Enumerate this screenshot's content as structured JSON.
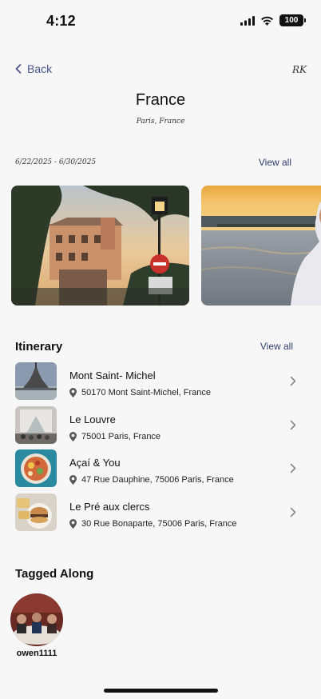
{
  "status": {
    "time": "4:12",
    "battery": "100"
  },
  "nav": {
    "back_label": "Back",
    "user_initials": "RK"
  },
  "trip": {
    "title": "France",
    "location": "Paris, France",
    "dates": "6/22/2025 - 6/30/2025",
    "photos_view_all": "View all"
  },
  "itinerary": {
    "title": "Itinerary",
    "view_all": "View all",
    "items": [
      {
        "name": "Mont Saint- Michel",
        "address": "50170 Mont Saint-Michel, France"
      },
      {
        "name": "Le Louvre",
        "address": "75001 Paris, France"
      },
      {
        "name": "Açaí & You",
        "address": "47 Rue Dauphine, 75006 Paris, France"
      },
      {
        "name": "Le Pré aux clercs",
        "address": "30 Rue Bonaparte, 75006 Paris, France"
      }
    ]
  },
  "tagged": {
    "title": "Tagged Along",
    "people": [
      {
        "username": "owen1111"
      }
    ]
  },
  "colors": {
    "accent": "#2f3f6f",
    "background": "#f7f7f7",
    "text": "#111111"
  },
  "icons": [
    "signal-icon",
    "wifi-icon",
    "battery-icon",
    "back-chevron-icon",
    "map-pin-icon",
    "chevron-right-icon"
  ]
}
